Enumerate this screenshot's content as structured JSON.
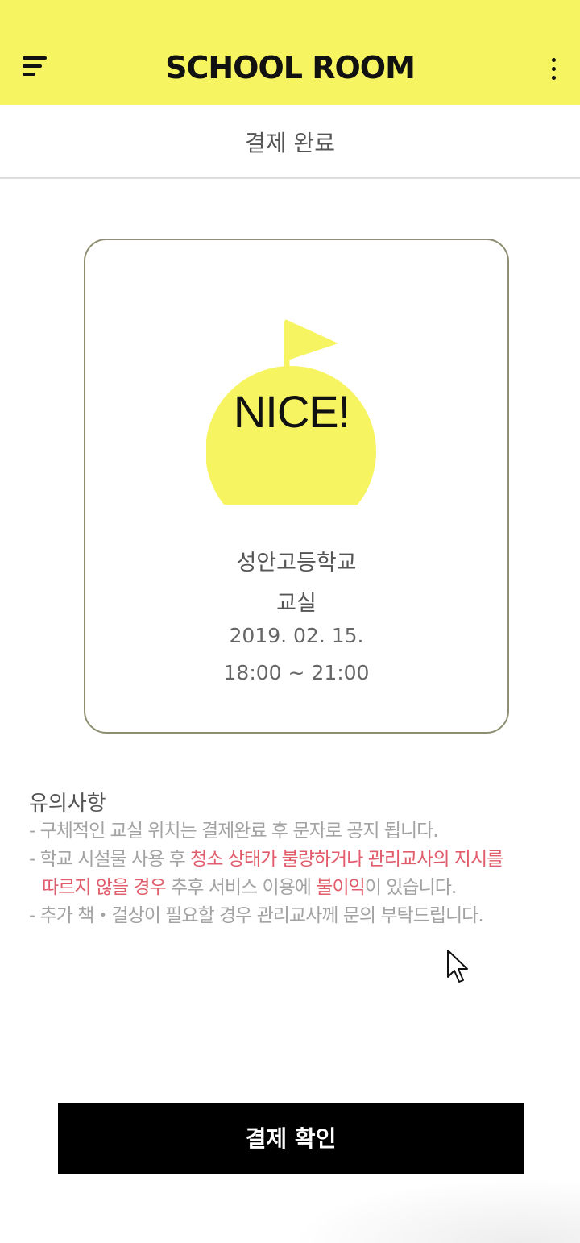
{
  "app_bar": {
    "title": "SCHOOL ROOM",
    "menu_icon": "hamburger-menu-icon",
    "more_icon": "more-vertical-icon",
    "background_color": "#f7f462"
  },
  "subheader": {
    "title": "결제 완료"
  },
  "booking_card": {
    "badge_text": "NICE!",
    "badge_icon": "flag-icon",
    "badge_color": "#f7f462",
    "school": "성안고등학교",
    "room": "교실",
    "date": "2019. 02. 15.",
    "time": "18:00 ~ 21:00"
  },
  "notice": {
    "title": "유의사항",
    "line1": "- 구체적인 교실 위치는 결제완료 후 문자로 공지 됩니다.",
    "line2_part1": "- 학교 시설물 사용 후 ",
    "line2_highlight": "청소 상태가 불량하거나 관리교사의 지시를",
    "line3_highlight1": "따르지 않을 경우",
    "line3_part2": " 추후 서비스 이용에 ",
    "line3_highlight2": "불이익",
    "line3_part3": "이 있습니다.",
    "line4": "- 추가 책・걸상이 필요할 경우 관리교사께 문의 부탁드립니다.",
    "highlight_color": "#e25d6c"
  },
  "footer": {
    "confirm_button": "결제 확인"
  }
}
